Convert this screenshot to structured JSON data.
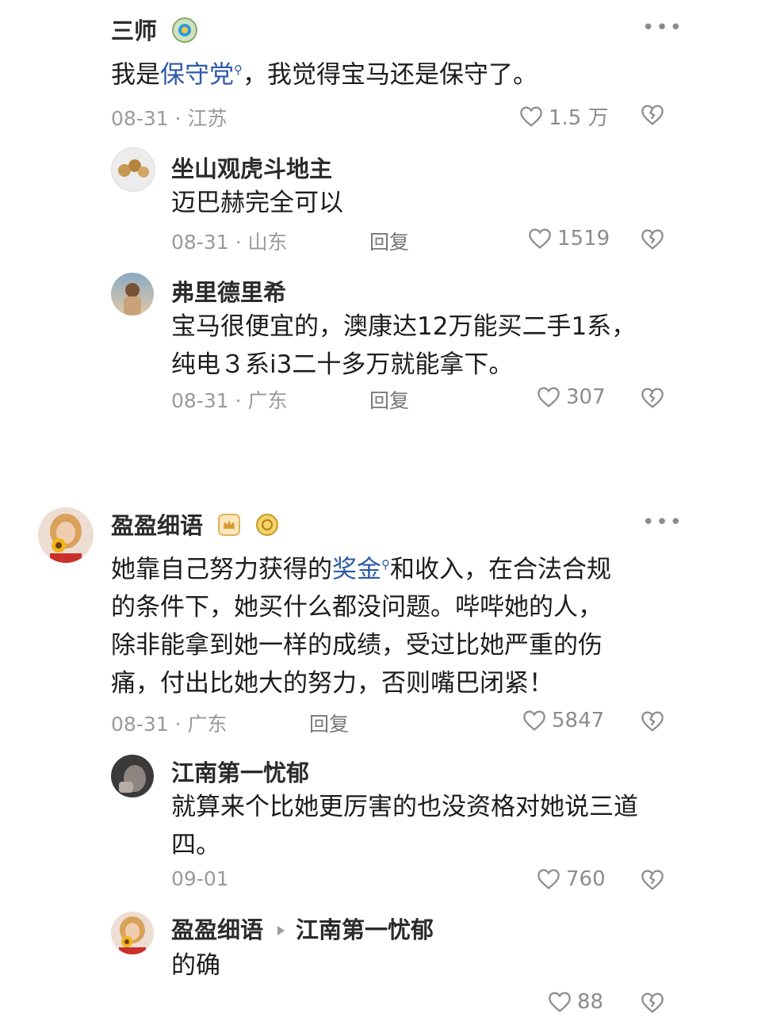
{
  "comments": [
    {
      "name": "三师",
      "text_parts": [
        "我是",
        "保守党",
        "，我觉得宝马还是保守了。"
      ],
      "date": "08-31",
      "location": "江苏",
      "likes": "1.5 万",
      "replies": [
        {
          "name": "坐山观虎斗地主",
          "text": "迈巴赫完全可以",
          "date": "08-31",
          "location": "山东",
          "reply_label": "回复",
          "likes": "1519"
        },
        {
          "name": "弗里德里希",
          "text_lines": [
            "宝马很便宜的，澳康达12万能买二手1系，",
            "纯电３系i3二十多万就能拿下。"
          ],
          "date": "08-31",
          "location": "广东",
          "reply_label": "回复",
          "likes": "307"
        }
      ]
    },
    {
      "name": "盈盈细语",
      "text_parts": [
        "她靠自己努力获得的",
        "奖金",
        "和收入，在合法合规"
      ],
      "text_lines": [
        "的条件下，她买什么都没问题。哔哔她的人，",
        "除非能拿到她一样的成绩，受过比她严重的伤",
        "痛，付出比她大的努力，否则嘴巴闭紧！"
      ],
      "date": "08-31",
      "location": "广东",
      "reply_label": "回复",
      "likes": "5847",
      "replies": [
        {
          "name": "江南第一忧郁",
          "text_lines": [
            "就算来个比她更厉害的也没资格对她说三道",
            "四。"
          ],
          "date": "09-01",
          "likes": "760"
        },
        {
          "name": "盈盈细语",
          "reply_to": "江南第一忧郁",
          "text": "的确",
          "likes": "88"
        }
      ]
    }
  ],
  "icons": {
    "like": "heart-outline-icon",
    "dislike": "broken-heart-icon",
    "more": "more-dots-icon"
  },
  "colors": {
    "link": "#2f5aa8",
    "meta": "#9a9a9a"
  }
}
